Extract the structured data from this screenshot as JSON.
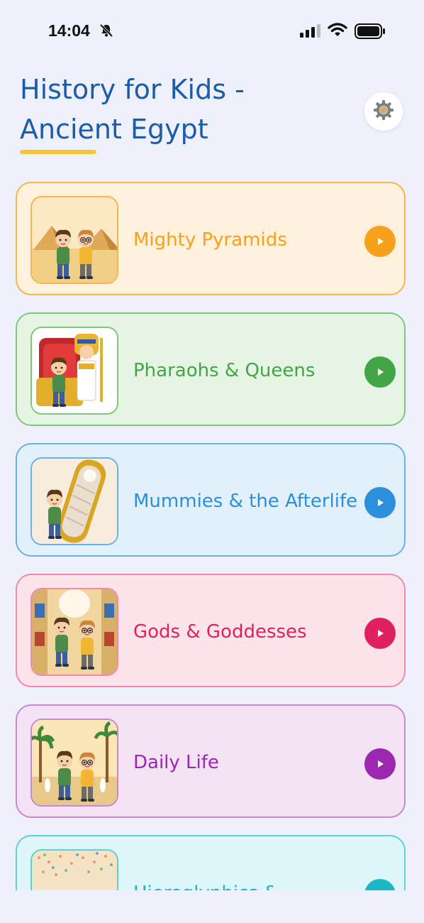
{
  "status_bar": {
    "time": "14:04",
    "icons": [
      "bell-slash-icon",
      "cellular-signal-icon",
      "wifi-icon",
      "battery-icon"
    ]
  },
  "header": {
    "title_line1": "History for Kids -",
    "title_line2": "Ancient Egypt",
    "settings_icon": "gear-icon"
  },
  "topics": [
    {
      "label": "Mighty Pyramids",
      "accent": "#f5a11c",
      "bg": "#fff1db",
      "border": "#f5b550",
      "thumb": "pyramids"
    },
    {
      "label": "Pharaohs & Queens",
      "accent": "#43a547",
      "bg": "#e6f4e4",
      "border": "#7ec77d",
      "thumb": "pharaoh"
    },
    {
      "label": "Mummies & the Afterlife",
      "accent": "#2b8fdb",
      "bg": "#e1f0fb",
      "border": "#6ab2e6",
      "thumb": "mummy"
    },
    {
      "label": "Gods & Goddesses",
      "accent": "#e0215f",
      "bg": "#fde3ea",
      "border": "#f08aa8",
      "thumb": "gods"
    },
    {
      "label": "Daily Life",
      "accent": "#9c27b0",
      "bg": "#f3e3f5",
      "border": "#c889d3",
      "thumb": "daily"
    },
    {
      "label": "Hieroglyphics &",
      "accent": "#19b8c6",
      "bg": "#ddf6f8",
      "border": "#5fd0da",
      "thumb": "hieroglyphs"
    }
  ]
}
